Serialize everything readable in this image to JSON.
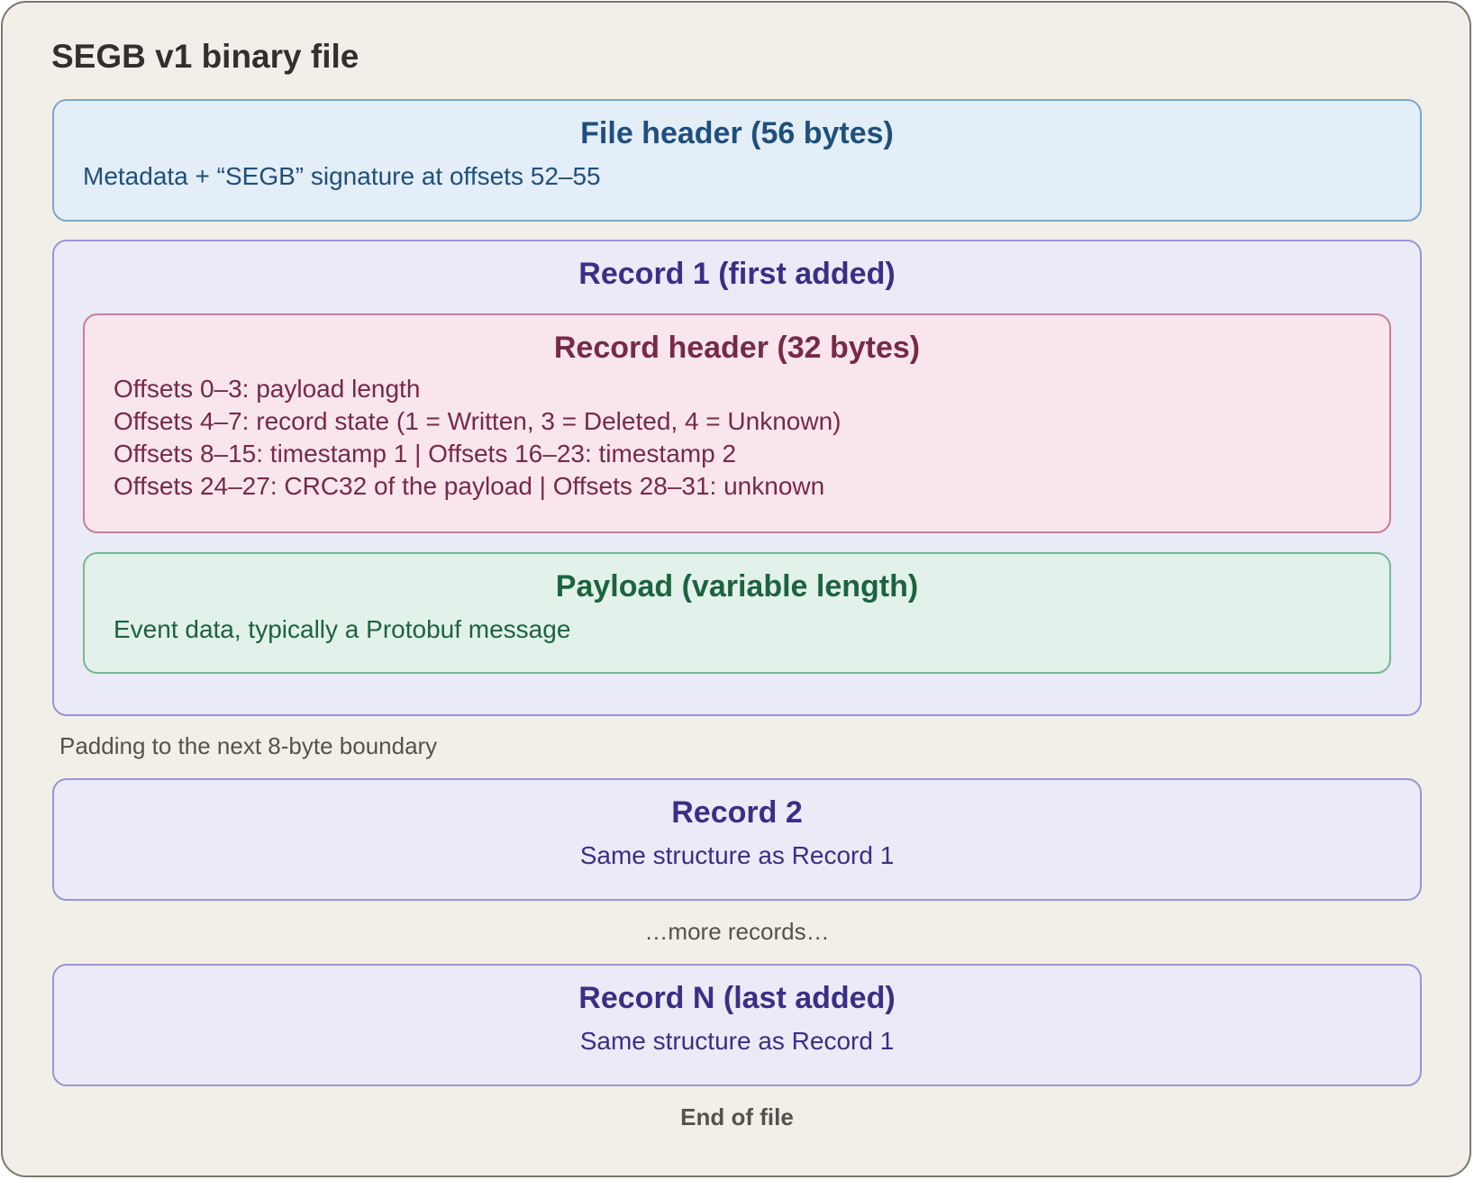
{
  "diagram": {
    "title": "SEGB v1 binary file",
    "file_header": {
      "title": "File header (56 bytes)",
      "description": "Metadata + “SEGB” signature at offsets 52–55"
    },
    "record_1": {
      "title": "Record 1 (first added)",
      "record_header": {
        "title": "Record header (32 bytes)",
        "lines": [
          "Offsets 0–3: payload length",
          "Offsets 4–7: record state (1 = Written, 3 = Deleted, 4 = Unknown)",
          "Offsets 8–15: timestamp 1  |  Offsets 16–23: timestamp 2",
          "Offsets 24–27: CRC32 of the payload  |  Offsets 28–31: unknown"
        ]
      },
      "payload": {
        "title": "Payload (variable length)",
        "description": "Event data, typically a Protobuf message"
      }
    },
    "padding_note": "Padding to the next 8-byte boundary",
    "record_2": {
      "title": "Record 2",
      "description": "Same structure as Record 1"
    },
    "more_records_note": "…more records…",
    "record_n": {
      "title": "Record N (last added)",
      "description": "Same structure as Record 1"
    },
    "end_note": "End of file"
  }
}
